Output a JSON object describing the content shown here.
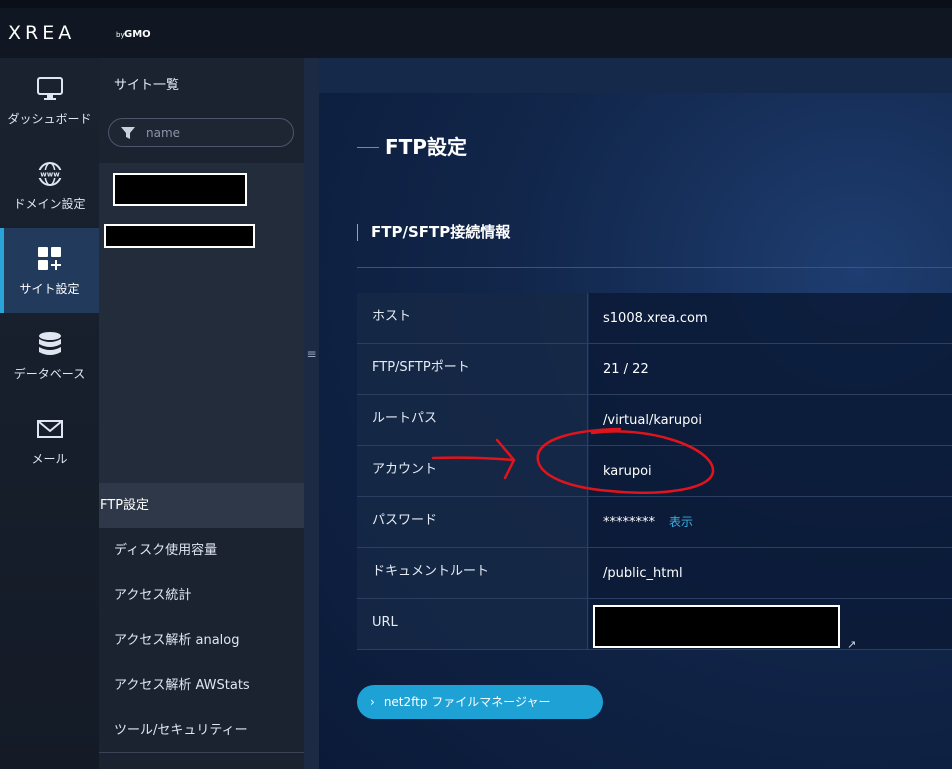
{
  "brand": {
    "logo": "XREA",
    "by": "by",
    "company": "GMO"
  },
  "nav": {
    "items": [
      {
        "label": "ダッシュボード",
        "icon": "monitor-icon"
      },
      {
        "label": "ドメイン設定",
        "icon": "globe-www-icon"
      },
      {
        "label": "サイト設定",
        "icon": "grid-plus-icon",
        "active": true
      },
      {
        "label": "データベース",
        "icon": "database-icon"
      },
      {
        "label": "メール",
        "icon": "envelope-icon"
      }
    ]
  },
  "site_panel": {
    "title": "サイト一覧",
    "filter_placeholder": "name",
    "menu": [
      {
        "label": "FTP設定",
        "active": true
      },
      {
        "label": "ディスク使用容量"
      },
      {
        "label": "アクセス統計"
      },
      {
        "label": "アクセス解析 analog"
      },
      {
        "label": "アクセス解析 AWStats"
      },
      {
        "label": "ツール/セキュリティー"
      }
    ]
  },
  "main": {
    "page_title": "FTP設定",
    "section_title": "FTP/SFTP接続情報",
    "rows": [
      {
        "key": "ホスト",
        "value": "s1008.xrea.com"
      },
      {
        "key": "FTP/SFTPポート",
        "value": "21 / 22"
      },
      {
        "key": "ルートパス",
        "value": "/virtual/karupoi"
      },
      {
        "key": "アカウント",
        "value": "karupoi"
      },
      {
        "key": "パスワード",
        "value": "********",
        "link": "表示"
      },
      {
        "key": "ドキュメントルート",
        "value": "/public_html"
      },
      {
        "key": "URL",
        "value": ""
      }
    ],
    "ftp_button": "net2ftp ファイルマネージャー"
  },
  "colors": {
    "accent": "#1ea2d6",
    "annotation": "#e0141c"
  }
}
